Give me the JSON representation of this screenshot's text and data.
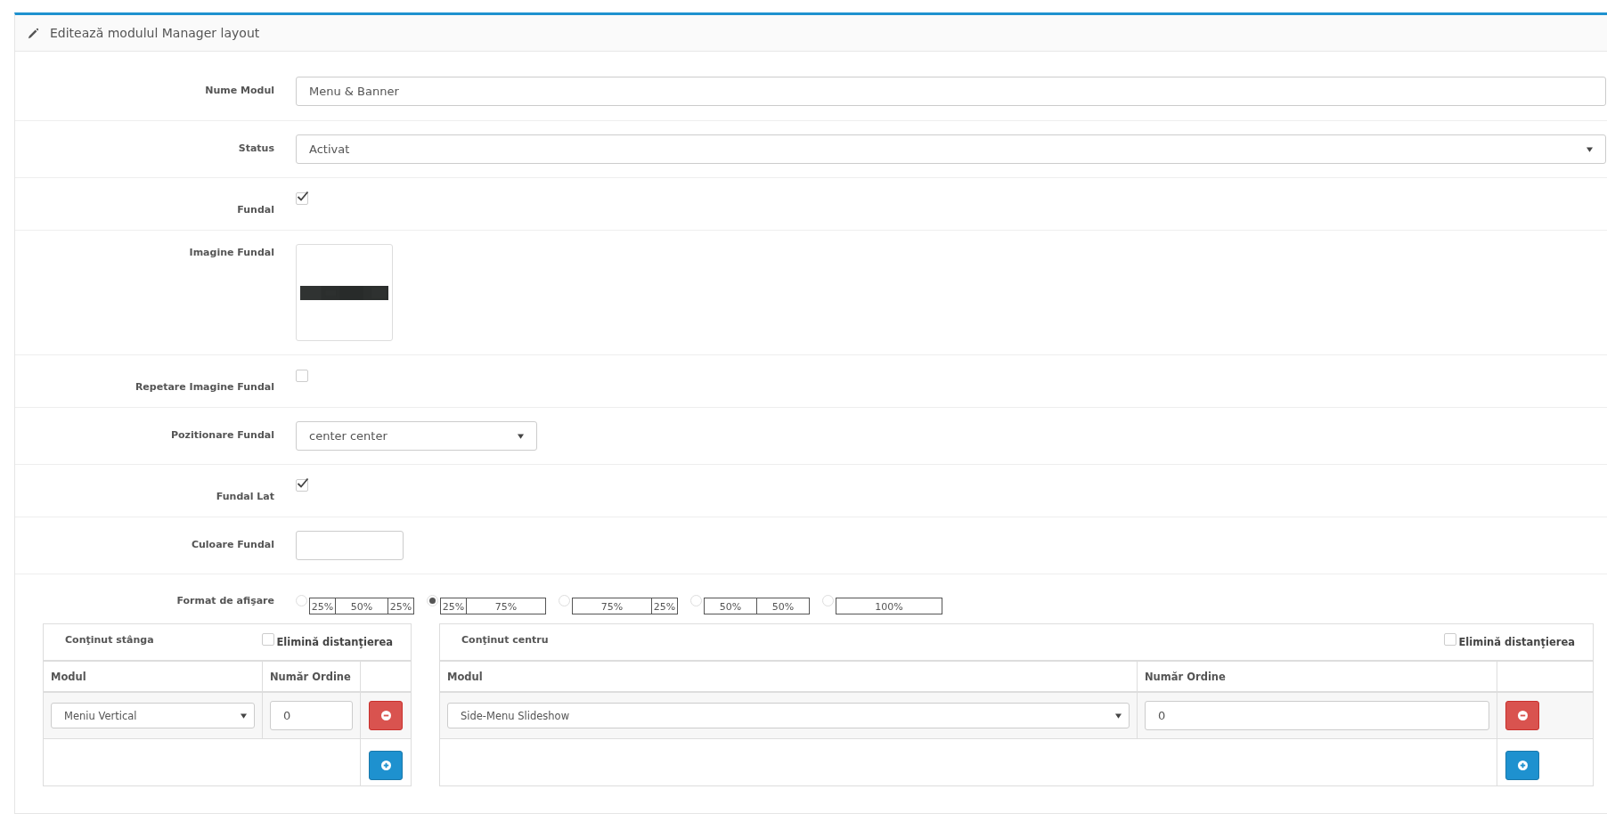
{
  "panel": {
    "title": "Editează modulul Manager layout"
  },
  "form": [
    {
      "kind": "text",
      "label": "Nume Modul",
      "value": "Menu & Banner"
    },
    {
      "kind": "select",
      "label": "Status",
      "value": "Activat"
    },
    {
      "kind": "checkbox",
      "label": "Fundal",
      "checked": true
    },
    {
      "label": "Imagine Fundal"
    },
    {
      "kind": "checkbox",
      "label": "Repetare Imagine Fundal",
      "checked": false
    },
    {
      "kind": "compact-select",
      "label": "Pozitionare Fundal",
      "value": "center center"
    },
    {
      "kind": "checkbox",
      "label": "Fundal Lat",
      "checked": true
    },
    {
      "kind": "color",
      "label": "Culoare Fundal"
    }
  ],
  "display_format": {
    "label": "Format de afişare",
    "options": [
      {
        "selected": false,
        "segments": [
          "25%",
          "50%",
          "25%"
        ]
      },
      {
        "selected": true,
        "segments": [
          "25%",
          "75%"
        ]
      },
      {
        "selected": false,
        "segments": [
          "75%",
          "25%"
        ]
      },
      {
        "selected": false,
        "segments": [
          "50%",
          "50%"
        ]
      },
      {
        "selected": false,
        "segments": [
          "100%"
        ]
      }
    ]
  },
  "sections": [
    {
      "kind": "left",
      "title": "Conţinut stânga",
      "remove_spacing": {
        "label": "Elimină distanţierea",
        "checked": false
      },
      "columns": [
        "Modul",
        "Număr Ordine"
      ],
      "rows": [
        {
          "module": "Meniu Vertical",
          "order": "0"
        }
      ]
    },
    {
      "kind": "center",
      "title": "Conţinut centru",
      "remove_spacing": {
        "label": "Elimină distanţierea",
        "checked": false
      },
      "columns": [
        "Modul",
        "Număr Ordine"
      ],
      "rows": [
        {
          "module": "Side-Menu Slideshow",
          "order": "0"
        }
      ]
    }
  ]
}
